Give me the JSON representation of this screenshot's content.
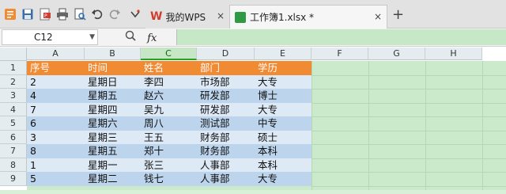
{
  "toolbar": {
    "icons": [
      "wps-logo-icon",
      "save-icon",
      "export-pdf-icon",
      "print-icon",
      "print-preview-icon",
      "undo-icon",
      "redo-icon",
      "more-icon"
    ]
  },
  "tabs": [
    {
      "label": "我的WPS",
      "close": "×"
    },
    {
      "label": "工作簿1.xlsx *",
      "close": "×"
    }
  ],
  "new_tab": "+",
  "name_box": "C12",
  "fx_label": "fx",
  "columns": [
    "A",
    "B",
    "C",
    "D",
    "E",
    "F",
    "G",
    "H"
  ],
  "rows": [
    "1",
    "2",
    "3",
    "4",
    "5",
    "6",
    "7",
    "8",
    "9"
  ],
  "table": {
    "headers": [
      "序号",
      "时间",
      "姓名",
      "部门",
      "学历"
    ],
    "data": [
      [
        "2",
        "星期日",
        "李四",
        "市场部",
        "大专"
      ],
      [
        "4",
        "星期五",
        "赵六",
        "研发部",
        "博士"
      ],
      [
        "7",
        "星期四",
        "吴九",
        "研发部",
        "大专"
      ],
      [
        "6",
        "星期六",
        "周八",
        "测试部",
        "中专"
      ],
      [
        "3",
        "星期三",
        "王五",
        "财务部",
        "硕士"
      ],
      [
        "8",
        "星期五",
        "郑十",
        "财务部",
        "本科"
      ],
      [
        "1",
        "星期一",
        "张三",
        "人事部",
        "本科"
      ],
      [
        "5",
        "星期二",
        "钱七",
        "人事部",
        "大专"
      ]
    ]
  },
  "colors": {
    "header_orange": "#f08a33",
    "row_light": "#dde9f5",
    "row_dark": "#bcd4ec",
    "sheet_green": "#cbe9cb"
  }
}
